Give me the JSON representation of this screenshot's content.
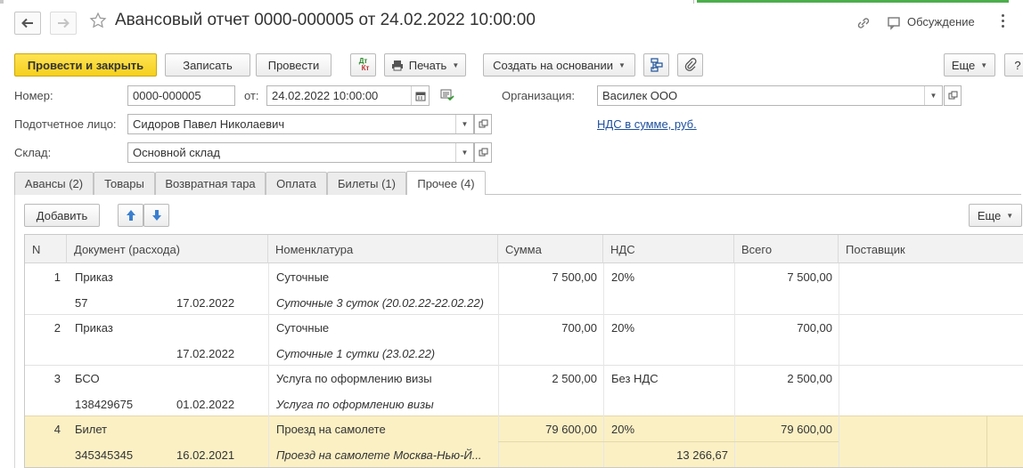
{
  "header": {
    "title": "Авансовый отчет 0000-000005 от 24.02.2022 10:00:00",
    "discussion_label": "Обсуждение"
  },
  "toolbar": {
    "post_close": "Провести и закрыть",
    "write": "Записать",
    "post": "Провести",
    "dtkt_top": "Дт",
    "dtkt_bottom": "Кт",
    "print": "Печать",
    "create_based": "Создать на основании",
    "more": "Еще",
    "help": "?"
  },
  "form": {
    "number_label": "Номер:",
    "number_value": "0000-000005",
    "date_label": "от:",
    "date_value": "24.02.2022 10:00:00",
    "org_label": "Организация:",
    "org_value": "Василек ООО",
    "person_label": "Подотчетное лицо:",
    "person_value": "Сидоров Павел Николаевич",
    "nds_link": "НДС в сумме, руб.",
    "warehouse_label": "Склад:",
    "warehouse_value": "Основной склад"
  },
  "tabs": [
    {
      "label": "Авансы (2)"
    },
    {
      "label": "Товары"
    },
    {
      "label": "Возвратная тара"
    },
    {
      "label": "Оплата"
    },
    {
      "label": "Билеты (1)"
    },
    {
      "label": "Прочее (4)"
    }
  ],
  "table_toolbar": {
    "add": "Добавить",
    "more": "Еще"
  },
  "table": {
    "columns": [
      "N",
      "Документ (расхода)",
      "Номенклатура",
      "Сумма",
      "НДС",
      "Всего",
      "Поставщик"
    ],
    "rows": [
      {
        "n": "1",
        "doc": "Приказ",
        "doc_num": "57",
        "doc_date": "17.02.2022",
        "nom": "Суточные",
        "nom_desc": "Суточные 3 суток (20.02.22-22.02.22)",
        "sum": "7 500,00",
        "nds": "20%",
        "nds_sum": "",
        "total": "7 500,00",
        "supplier": ""
      },
      {
        "n": "2",
        "doc": "Приказ",
        "doc_num": "",
        "doc_date": "17.02.2022",
        "nom": "Суточные",
        "nom_desc": "Суточные 1 сутки (23.02.22)",
        "sum": "700,00",
        "nds": "20%",
        "nds_sum": "",
        "total": "700,00",
        "supplier": ""
      },
      {
        "n": "3",
        "doc": "БСО",
        "doc_num": "138429675",
        "doc_date": "01.02.2022",
        "nom": "Услуга по оформлению визы",
        "nom_desc": "Услуга по оформлению визы",
        "sum": "2 500,00",
        "nds": "Без НДС",
        "nds_sum": "",
        "total": "2 500,00",
        "supplier": ""
      },
      {
        "n": "4",
        "doc": "Билет",
        "doc_num": "345345345",
        "doc_date": "16.02.2021",
        "nom": "Проезд на самолете",
        "nom_desc": "Проезд на самолете Москва-Нью-Й...",
        "sum": "79 600,00",
        "nds": "20%",
        "nds_sum": "13 266,67",
        "total": "79 600,00",
        "supplier": ""
      }
    ]
  },
  "colors": {
    "primary_button": "#f5d01e",
    "selected_row": "#fbf0c4",
    "link": "#1d4f9e",
    "accent_green": "#4cae4c"
  }
}
